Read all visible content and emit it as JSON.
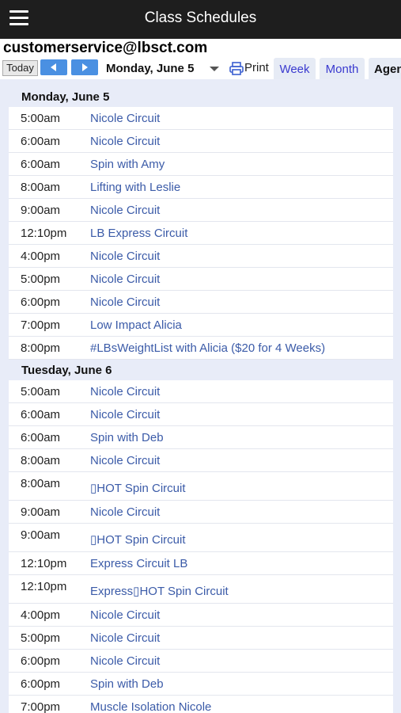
{
  "app": {
    "title": "Class Schedules"
  },
  "account": {
    "email": "customerservice@lbsct.com"
  },
  "toolbar": {
    "today_label": "Today",
    "current_date": "Monday, June 5",
    "print_label": "Print",
    "tabs": [
      "Week",
      "Month",
      "Agenda"
    ]
  },
  "days": [
    {
      "heading": "Monday, June 5",
      "events": [
        {
          "time": "5:00am",
          "title": "Nicole Circuit"
        },
        {
          "time": "6:00am",
          "title": "Nicole Circuit"
        },
        {
          "time": "6:00am",
          "title": "Spin with Amy"
        },
        {
          "time": "8:00am",
          "title": "Lifting with Leslie"
        },
        {
          "time": "9:00am",
          "title": "Nicole Circuit"
        },
        {
          "time": "12:10pm",
          "title": "LB Express Circuit"
        },
        {
          "time": "4:00pm",
          "title": "Nicole Circuit"
        },
        {
          "time": "5:00pm",
          "title": "Nicole Circuit"
        },
        {
          "time": "6:00pm",
          "title": "Nicole Circuit"
        },
        {
          "time": "7:00pm",
          "title": "Low Impact Alicia"
        },
        {
          "time": "8:00pm",
          "title": "#LBsWeightList with Alicia ($20 for 4 Weeks)"
        }
      ]
    },
    {
      "heading": "Tuesday, June 6",
      "events": [
        {
          "time": "5:00am",
          "title": "Nicole Circuit"
        },
        {
          "time": "6:00am",
          "title": "Nicole Circuit"
        },
        {
          "time": "6:00am",
          "title": "Spin with Deb"
        },
        {
          "time": "8:00am",
          "title": "Nicole Circuit"
        },
        {
          "time": "8:00am",
          "title": "▯HOT Spin Circuit"
        },
        {
          "time": "9:00am",
          "title": "Nicole Circuit"
        },
        {
          "time": "9:00am",
          "title": "▯HOT Spin Circuit"
        },
        {
          "time": "12:10pm",
          "title": "Express Circuit LB"
        },
        {
          "time": "12:10pm",
          "title": "Express▯HOT Spin Circuit"
        },
        {
          "time": "4:00pm",
          "title": "Nicole Circuit"
        },
        {
          "time": "5:00pm",
          "title": "Nicole Circuit"
        },
        {
          "time": "6:00pm",
          "title": "Nicole Circuit"
        },
        {
          "time": "6:00pm",
          "title": "Spin with Deb"
        },
        {
          "time": "7:00pm",
          "title": "Muscle Isolation Nicole"
        }
      ]
    }
  ],
  "colors": {
    "appbar": "#1e1e1e",
    "nav_button": "#4a90e2",
    "link": "#3b5ba8",
    "agenda_bg": "#e8ecf8"
  }
}
